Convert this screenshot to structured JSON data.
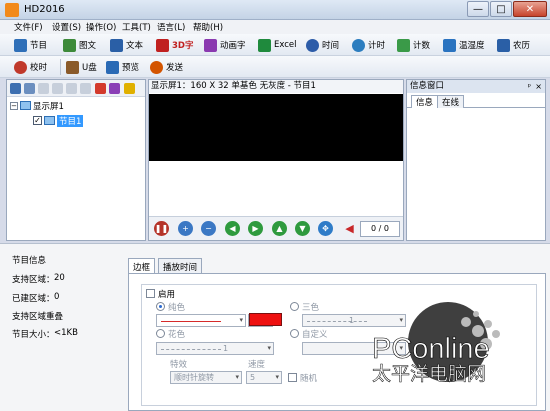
{
  "window": {
    "title": "HD2016",
    "min": "—",
    "max": "□",
    "close": "✕"
  },
  "menu": [
    "文件(F)",
    "设置(S)",
    "操作(O)",
    "工具(T)",
    "语言(L)",
    "帮助(H)"
  ],
  "toolbar1": [
    {
      "label": "节目",
      "color": "#2f6fb8"
    },
    {
      "label": "图文",
      "color": "#3d8a3a"
    },
    {
      "label": "文本",
      "color": "#2a5fa6"
    },
    {
      "label": "3D字",
      "color": "#c02020"
    },
    {
      "label": "动画字",
      "color": "#8a39b0"
    },
    {
      "label": "Excel",
      "color": "#1f8a3d"
    },
    {
      "label": "时间",
      "color": "#2d5ca8"
    },
    {
      "label": "计时",
      "color": "#2c7dbf"
    },
    {
      "label": "计数",
      "color": "#3a9a48"
    },
    {
      "label": "温湿度",
      "color": "#2a73c0"
    },
    {
      "label": "农历",
      "color": "#2a5fa6"
    }
  ],
  "toolbar2": [
    {
      "label": "校时",
      "color": "#c0392b"
    },
    {
      "label": "U盘",
      "color": "#8a5a2a"
    },
    {
      "label": "预览",
      "color": "#2a6ab5"
    },
    {
      "label": "发送",
      "color": "#d35400"
    }
  ],
  "tree": {
    "screen": "显示屏1",
    "program": "节目1",
    "expander": "−",
    "check": "✓"
  },
  "preview": {
    "header": "显示屏1：160 X 32  单基色  无灰度 - 节目1",
    "pager": "0 / 0"
  },
  "info": {
    "title": "信息窗口",
    "pin": "ᵖ",
    "close": "×",
    "tabs": [
      "信息",
      "在线"
    ]
  },
  "program_info": {
    "title": "节目信息",
    "support_area_label": "支持区域：",
    "support_area_value": "20",
    "built_area_label": "已建区域：",
    "built_area_value": "0",
    "overlap_label": "支持区域重叠",
    "size_label": "节目大小：",
    "size_value": "<1KB"
  },
  "prop_tabs": [
    "边框",
    "播放时间"
  ],
  "border": {
    "enable": "启用",
    "pure": "纯色",
    "tri": "三色",
    "flower": "花色",
    "custom": "自定义",
    "width1": "1",
    "width2": "1",
    "width3": "1",
    "effect_label": "特效",
    "effect_value": "顺时针旋转",
    "speed_label": "速度",
    "speed_value": "5",
    "random": "随机",
    "red": "#ee1111"
  },
  "watermark": {
    "brand": "PConline",
    "domain": ".com.cn",
    "slogan": "太平洋电脑网"
  }
}
